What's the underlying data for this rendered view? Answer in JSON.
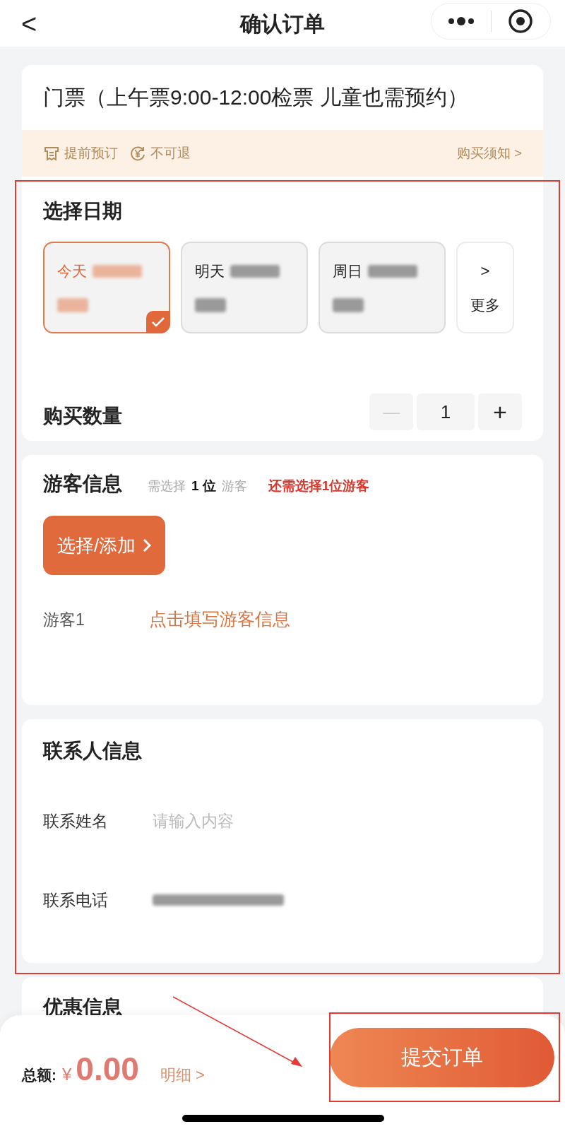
{
  "header": {
    "title": "确认订单",
    "back_icon": "<"
  },
  "ticket": {
    "title": "门票（上午票9:00-12:00检票 儿童也需预约）",
    "tags": [
      {
        "kind": "booking",
        "label": "提前预订"
      },
      {
        "kind": "refund",
        "label": "不可退"
      }
    ],
    "notice_link": "购买须知 >"
  },
  "date_section": {
    "title": "选择日期",
    "dates": [
      {
        "label": "今天",
        "redacted": true,
        "selected": true
      },
      {
        "label": "明天",
        "redacted": true,
        "selected": false
      },
      {
        "label": "周日",
        "redacted": true,
        "selected": false
      }
    ],
    "more": {
      "icon": ">",
      "label": "更多"
    }
  },
  "quantity": {
    "label": "购买数量",
    "minus": "—",
    "value": "1",
    "plus": "+",
    "minus_disabled": true
  },
  "visitors": {
    "title": "游客信息",
    "need_prefix": "需选择",
    "need_count": "1 位",
    "need_suffix": "游客",
    "warning": "还需选择1位游客",
    "add_button": "选择/添加",
    "rows": [
      {
        "label": "游客1",
        "action": "点击填写游客信息"
      }
    ]
  },
  "contact": {
    "title": "联系人信息",
    "fields": [
      {
        "label": "联系姓名",
        "placeholder": "请输入内容"
      },
      {
        "label": "联系电话",
        "redacted": true
      }
    ]
  },
  "discount": {
    "title": "优惠信息"
  },
  "footer": {
    "total_label": "总额:",
    "currency": "¥",
    "amount": "0.00",
    "detail_link": "明细 >",
    "submit": "提交订单"
  },
  "annotations": [
    {
      "kind": "rectangle"
    },
    {
      "kind": "rectangle"
    },
    {
      "kind": "arrow"
    }
  ]
}
